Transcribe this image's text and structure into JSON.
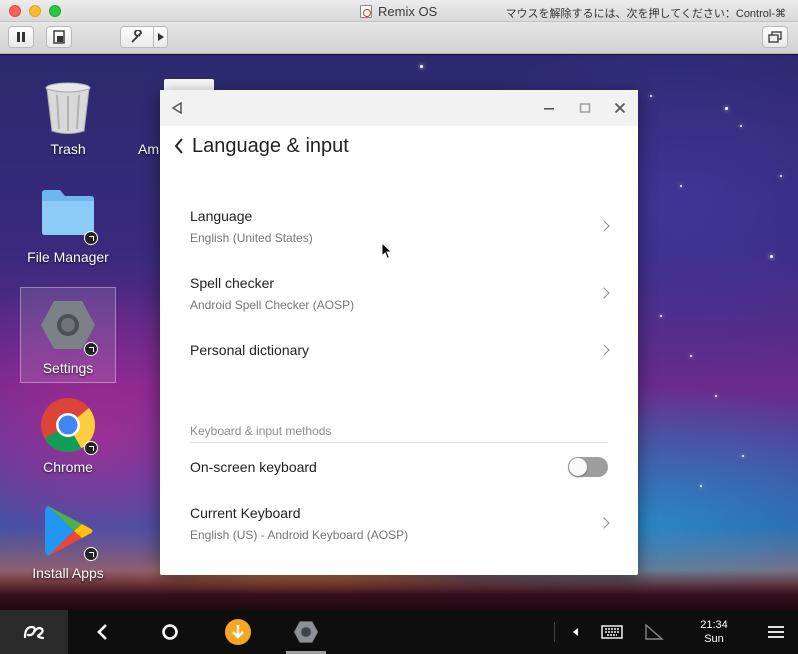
{
  "host": {
    "title": "Remix OS",
    "hint": "マウスを解除するには、次を押してください：Control-⌘"
  },
  "desktop_icons": [
    {
      "label": "Trash"
    },
    {
      "label": "File Manager"
    },
    {
      "label": "Settings"
    },
    {
      "label": "Chrome"
    },
    {
      "label": "Install Apps"
    },
    {
      "label": "Am"
    }
  ],
  "settings": {
    "title": "Language & input",
    "items": [
      {
        "main": "Language",
        "sub": "English (United States)"
      },
      {
        "main": "Spell checker",
        "sub": "Android Spell Checker (AOSP)"
      },
      {
        "main": "Personal dictionary"
      },
      {
        "main": "On-screen keyboard",
        "toggle": false
      },
      {
        "main": "Current Keyboard",
        "sub": "English (US) - Android Keyboard (AOSP)"
      }
    ],
    "section_label": "Keyboard & input methods"
  },
  "taskbar": {
    "time": "21:34",
    "day": "Sun"
  },
  "colors": {
    "accent_orange": "#f5a623",
    "taskbar": "#0e0e0e"
  }
}
